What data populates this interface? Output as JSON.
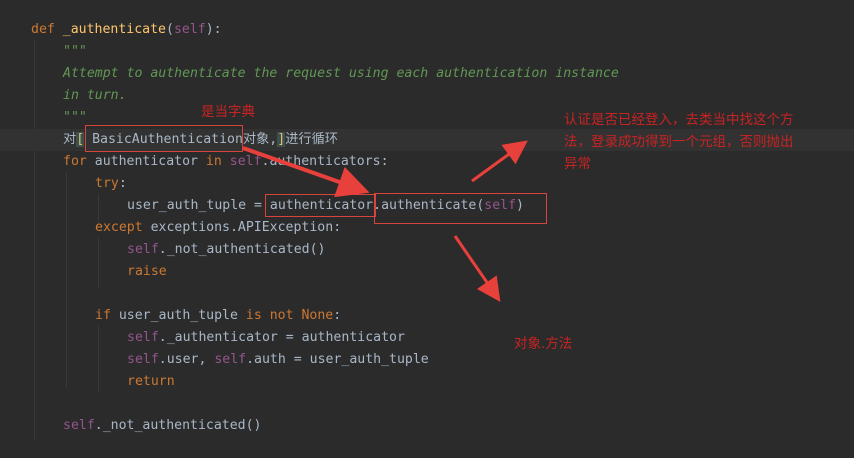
{
  "code": {
    "l1": {
      "def": "def",
      "name": "_authenticate",
      "open": "(",
      "self": "self",
      "close": "):"
    },
    "l2": {
      "doc": "\"\"\""
    },
    "l3": {
      "doc": "Attempt to authenticate the request using each authentication instance"
    },
    "l4": {
      "doc": "in turn."
    },
    "l5": {
      "doc": "\"\"\""
    },
    "l6": {
      "pre": "对",
      "bracket_open": "[",
      "mid": " BasicAuthentication对象,",
      "bracket_close": "]",
      "post": "进行循环"
    },
    "l7": {
      "for": "for",
      "a": " authenticator ",
      "in": "in",
      "sp": " ",
      "self": "self",
      "rest": ".authenticators:"
    },
    "l8": {
      "try": "try",
      "colon": ":"
    },
    "l9": {
      "text": "user_auth_tuple = authenticator.authenticate(",
      "self": "self",
      "close": ")"
    },
    "l10": {
      "except": "except",
      "rest": " exceptions.APIException:"
    },
    "l11": {
      "self": "self",
      "rest": "._not_authenticated()"
    },
    "l12": {
      "raise": "raise"
    },
    "l13": {
      "if": "if",
      "a": " user_auth_tuple ",
      "isnot": "is not",
      "sp": " ",
      "none": "None",
      "colon": ":"
    },
    "l14": {
      "self": "self",
      "rest": "._authenticator = authenticator"
    },
    "l15": {
      "self1": "self",
      "mid": ".user, ",
      "self2": "self",
      "rest": ".auth = user_auth_tuple"
    },
    "l16": {
      "return": "return"
    },
    "l17": {
      "self": "self",
      "rest": "._not_authenticated()"
    }
  },
  "annotations": {
    "class_instance": "是当字典",
    "explanation_line1": "认证是否已经登入，去类当中找这个方",
    "explanation_line2": "法，登录成功得到一个元组，否则抛出",
    "explanation_line3": "异常",
    "object_method": "对象.方法"
  },
  "colors": {
    "background": "#2b2b2b",
    "keyword": "#cc7832",
    "function": "#ffc66d",
    "self": "#94558d",
    "docstring": "#629755",
    "text": "#a9b7c6",
    "annotation": "#c82323",
    "box": "#d7443b"
  }
}
